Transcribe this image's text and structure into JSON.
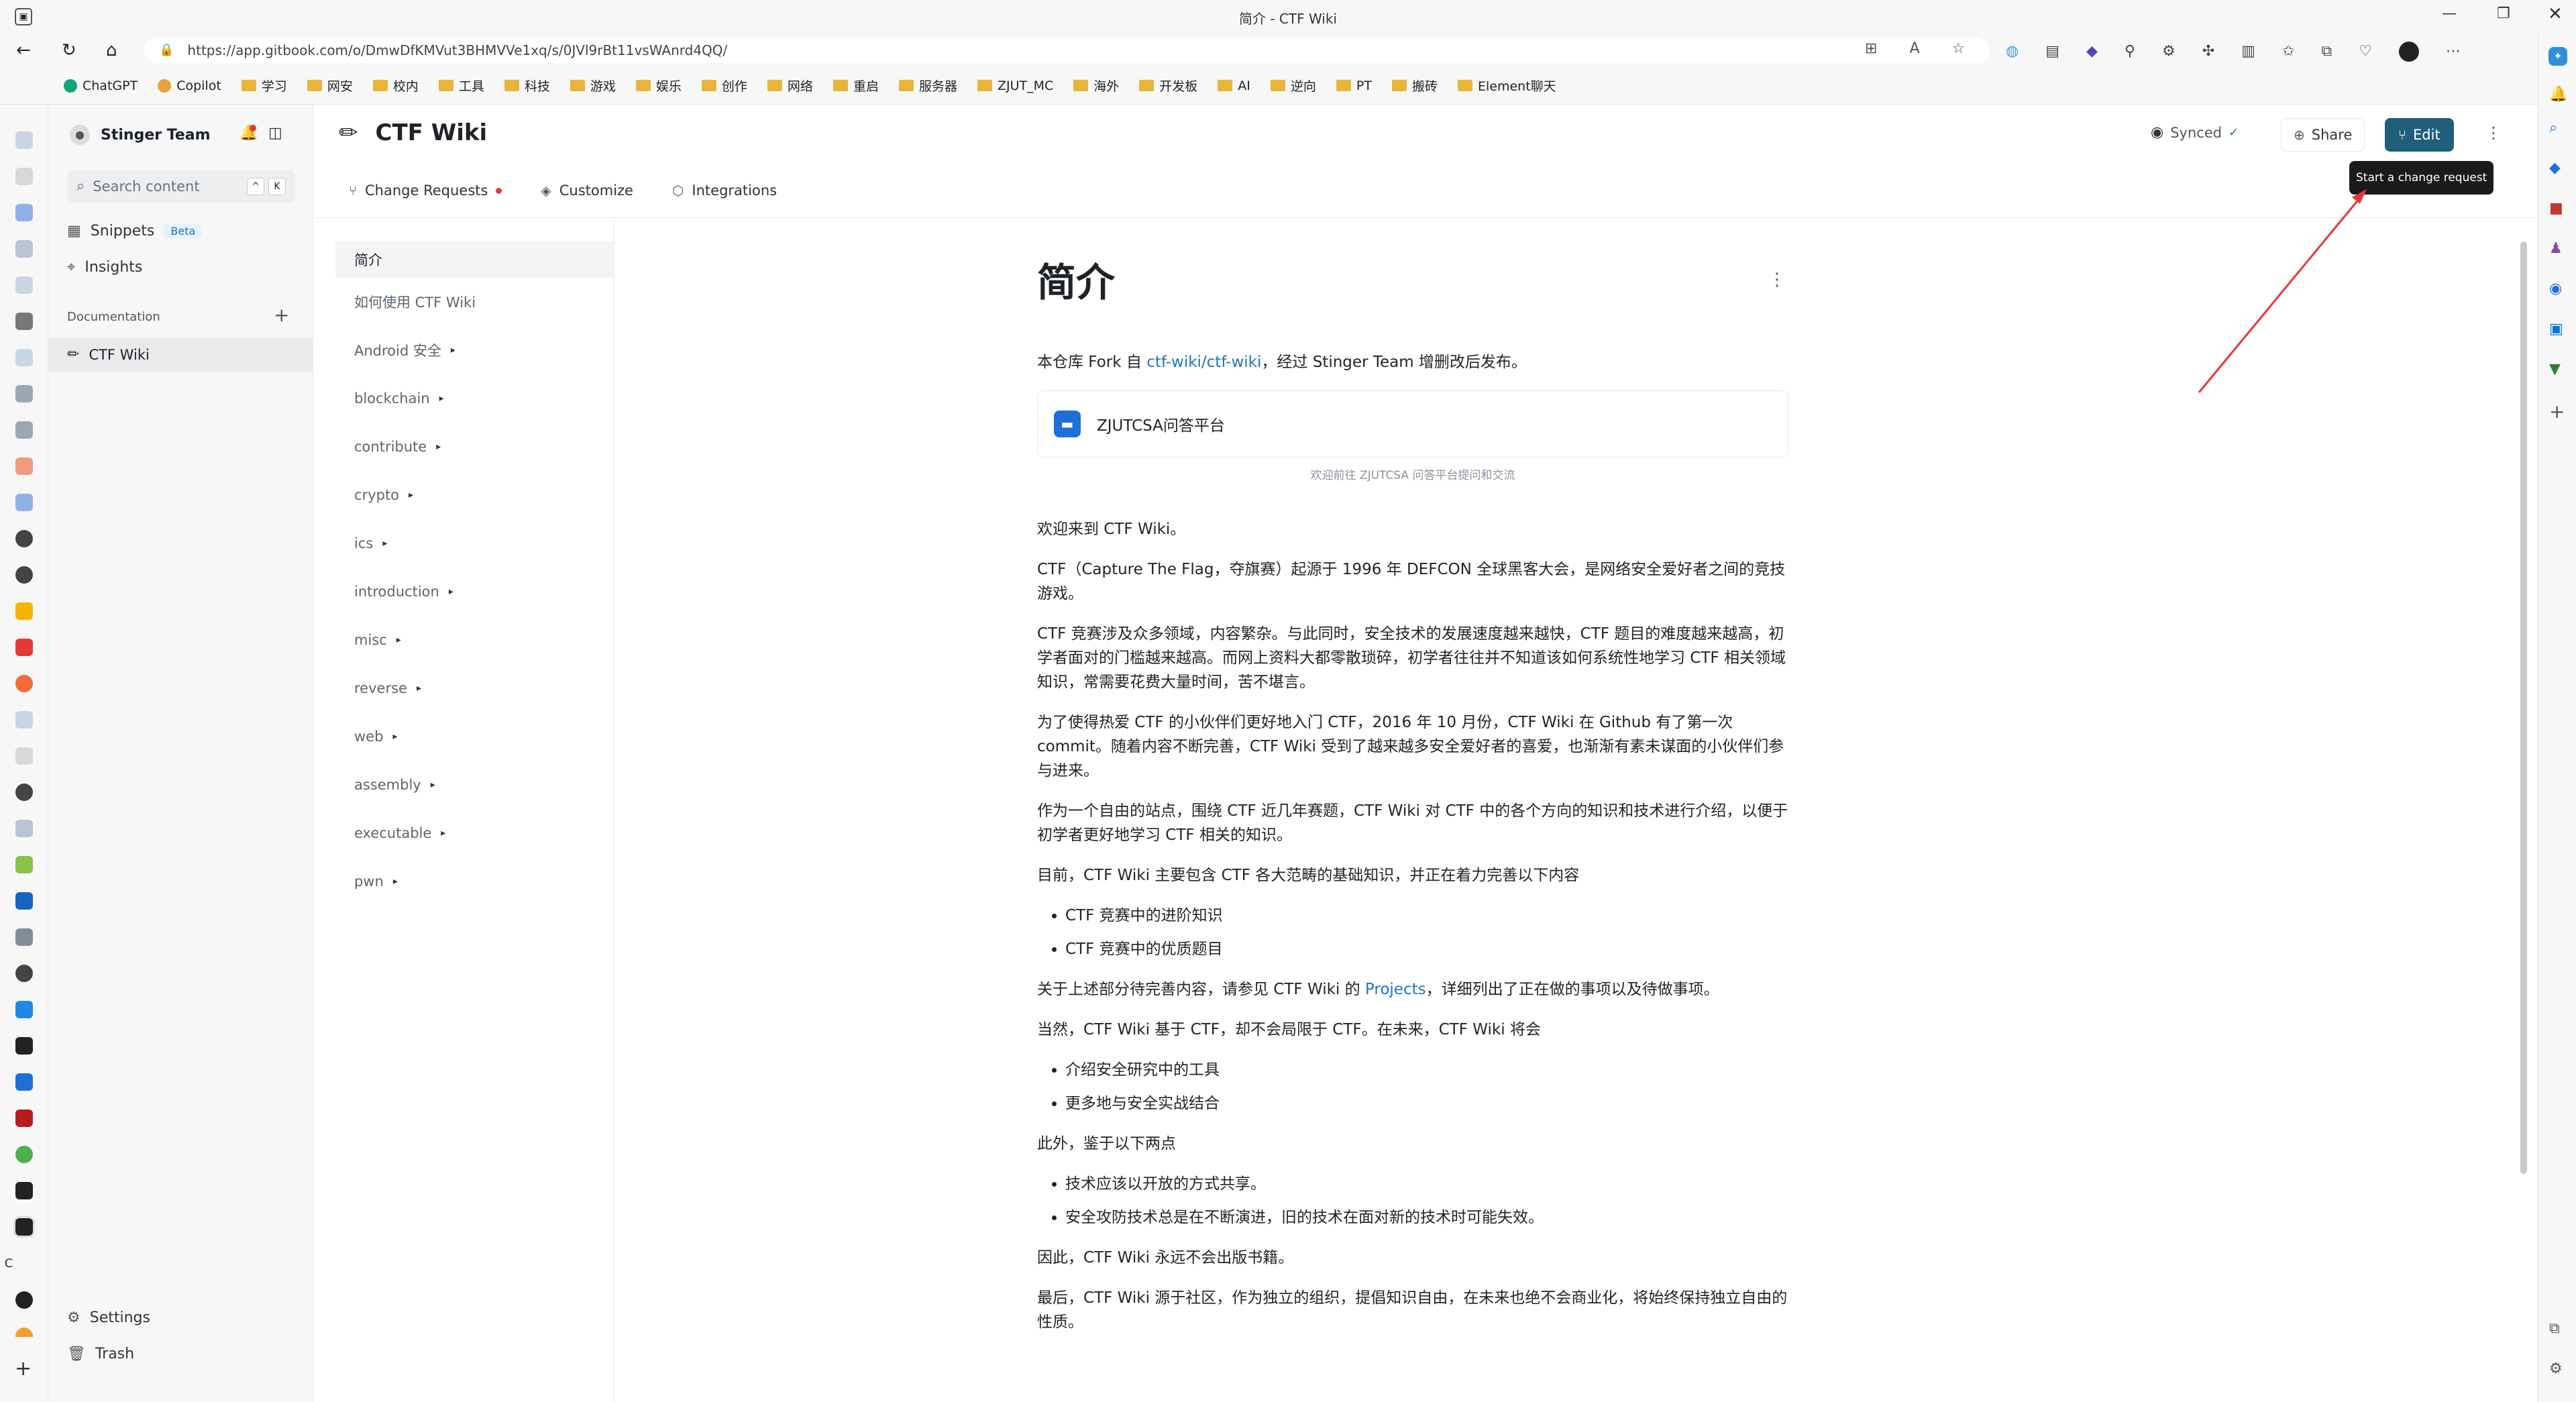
{
  "browser": {
    "tab_title": "简介 - CTF Wiki",
    "url": "https://app.gitbook.com/o/DmwDfKMVut3BHMVVe1xq/s/0JVl9rBt11vsWAnrd4QQ/",
    "bookmarks": [
      "ChatGPT",
      "Copilot",
      "学习",
      "网安",
      "校内",
      "工具",
      "科技",
      "游戏",
      "娱乐",
      "创作",
      "网络",
      "重启",
      "服务器",
      "ZJUT_MC",
      "海外",
      "开发板",
      "AI",
      "逆向",
      "PT",
      "搬砖",
      "Element聊天"
    ]
  },
  "sidebar": {
    "team": "Stinger Team",
    "search_placeholder": "Search content",
    "search_key1": "^",
    "search_key2": "K",
    "snippets": "Snippets",
    "beta": "Beta",
    "insights": "Insights",
    "documentation": "Documentation",
    "space": "CTF Wiki",
    "settings": "Settings",
    "trash": "Trash"
  },
  "header": {
    "title": "CTF Wiki",
    "synced": "Synced",
    "share": "Share",
    "edit": "Edit",
    "tooltip": "Start a change request",
    "tabs": [
      "Change Requests",
      "Customize",
      "Integrations"
    ]
  },
  "nav": {
    "items": [
      "简介",
      "如何使用 CTF Wiki",
      "Android 安全",
      "blockchain",
      "contribute",
      "crypto",
      "ics",
      "introduction",
      "misc",
      "reverse",
      "web",
      "assembly",
      "executable",
      "pwn"
    ]
  },
  "article": {
    "title": "简介",
    "intro_pre": "本仓库 Fork 自 ",
    "intro_link": "ctf-wiki/ctf-wiki",
    "intro_post": "，经过 Stinger Team 增删改后发布。",
    "embed_title": "ZJUTCSA问答平台",
    "embed_caption": "欢迎前往 ZJUTCSA 问答平台提问和交流",
    "p1": "欢迎来到 CTF Wiki。",
    "p2": "CTF（Capture The Flag，夺旗赛）起源于 1996 年 DEFCON 全球黑客大会，是网络安全爱好者之间的竞技游戏。",
    "p3": "CTF 竞赛涉及众多领域，内容繁杂。与此同时，安全技术的发展速度越来越快，CTF 题目的难度越来越高，初学者面对的门槛越来越高。而网上资料大都零散琐碎，初学者往往并不知道该如何系统性地学习 CTF 相关领域知识，常需要花费大量时间，苦不堪言。",
    "p4": "为了使得热爱 CTF 的小伙伴们更好地入门 CTF，2016 年 10 月份，CTF Wiki 在 Github 有了第一次 commit。随着内容不断完善，CTF Wiki 受到了越来越多安全爱好者的喜爱，也渐渐有素未谋面的小伙伴们参与进来。",
    "p5": "作为一个自由的站点，围绕 CTF 近几年赛题，CTF Wiki 对 CTF 中的各个方向的知识和技术进行介绍，以便于初学者更好地学习 CTF 相关的知识。",
    "p6": "目前，CTF Wiki 主要包含 CTF 各大范畴的基础知识，并正在着力完善以下内容",
    "list1": [
      "CTF 竞赛中的进阶知识",
      "CTF 竞赛中的优质题目"
    ],
    "p7_pre": "关于上述部分待完善内容，请参见 CTF Wiki 的 ",
    "p7_link": "Projects",
    "p7_post": "，详细列出了正在做的事项以及待做事项。",
    "p8": "当然，CTF Wiki 基于 CTF，却不会局限于 CTF。在未来，CTF Wiki 将会",
    "list2": [
      "介绍安全研究中的工具",
      "更多地与安全实战结合"
    ],
    "p9": "此外，鉴于以下两点",
    "list3": [
      "技术应该以开放的方式共享。",
      "安全攻防技术总是在不断演进，旧的技术在面对新的技术时可能失效。"
    ],
    "p10": "因此，CTF Wiki 永远不会出版书籍。",
    "p11": "最后，CTF Wiki 源于社区，作为独立的组织，提倡知识自由，在未来也绝不会商业化，将始终保持独立自由的性质。"
  },
  "colors": {
    "accent": "#1f5f7a",
    "link": "#1d77b8",
    "arrow": "#e53935"
  }
}
